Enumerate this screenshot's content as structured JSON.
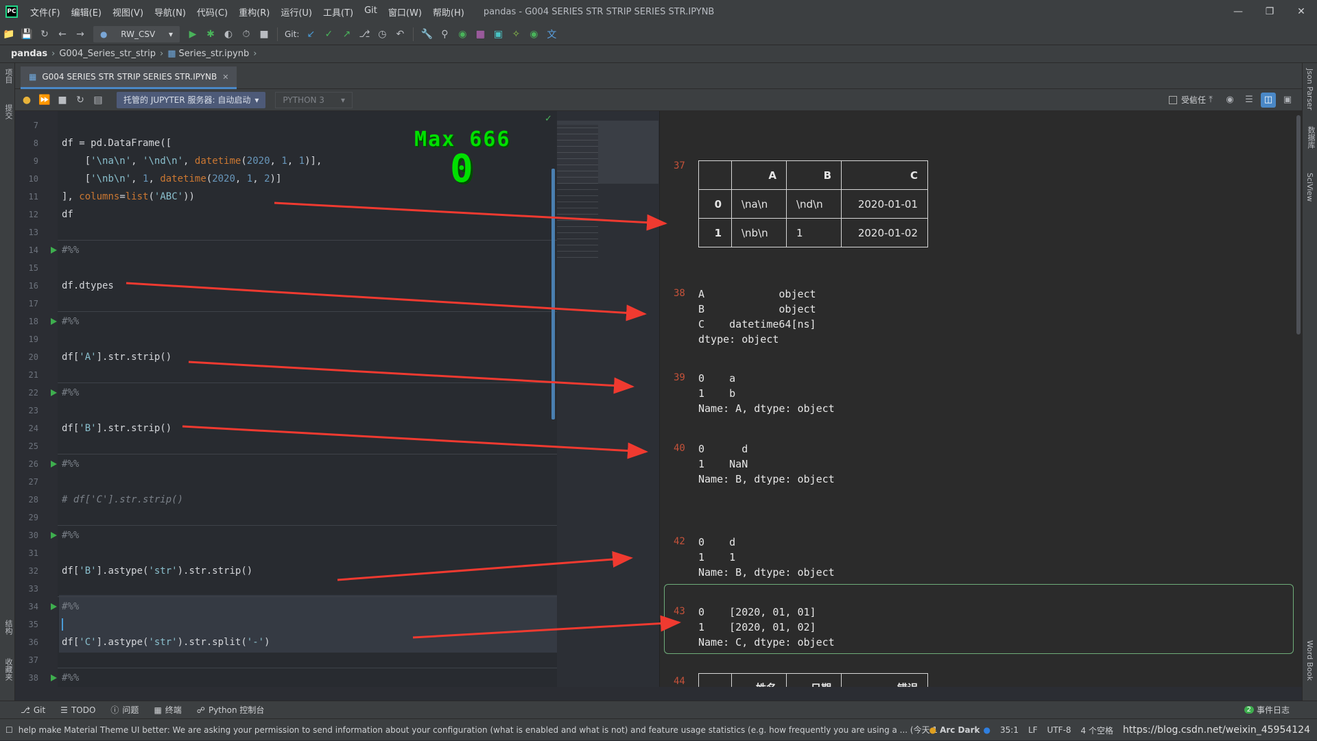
{
  "titlebar": {
    "menu": [
      "文件(F)",
      "编辑(E)",
      "视图(V)",
      "导航(N)",
      "代码(C)",
      "重构(R)",
      "运行(U)",
      "工具(T)",
      "Git",
      "窗口(W)",
      "帮助(H)"
    ],
    "title": "pandas - G004 SERIES STR STRIP SERIES STR.IPYNB"
  },
  "toolbar": {
    "run_config": "RW_CSV",
    "git_label": "Git:"
  },
  "breadcrumbs": {
    "project": "pandas",
    "folder": "G004_Series_str_strip",
    "file": "Series_str.ipynb"
  },
  "tab": {
    "label": "G004 SERIES STR STRIP SERIES STR.IPYNB"
  },
  "notebook": {
    "jupyter": "托管的 JUPYTER 服务器: 自动启动",
    "kernel": "PYTHON 3",
    "trusted": "受信任"
  },
  "side": {
    "left_project": "项目",
    "left_commit": "提交",
    "left_struct": "结构",
    "left_fav": "收藏夹",
    "right_json": "Json Parser",
    "right_db": "数据库",
    "right_sci": "SciView",
    "right_word": "Word Book"
  },
  "overlay": {
    "max_label": "Max 666",
    "max_value": "0"
  },
  "code_lines": [
    {
      "n": "7",
      "code": ""
    },
    {
      "n": "8",
      "code": "df = pd.DataFrame(["
    },
    {
      "n": "9",
      "code": "    ['\\na\\n', '\\nd\\n', datetime(2020, 1, 1)],"
    },
    {
      "n": "10",
      "code": "    ['\\nb\\n', 1, datetime(2020, 1, 2)]"
    },
    {
      "n": "11",
      "code": "], columns=list('ABC'))"
    },
    {
      "n": "12",
      "code": "df"
    },
    {
      "n": "13",
      "code": ""
    },
    {
      "n": "14",
      "code": "#%%"
    },
    {
      "n": "15",
      "code": ""
    },
    {
      "n": "16",
      "code": "df.dtypes"
    },
    {
      "n": "17",
      "code": ""
    },
    {
      "n": "18",
      "code": "#%%"
    },
    {
      "n": "19",
      "code": ""
    },
    {
      "n": "20",
      "code": "df['A'].str.strip()"
    },
    {
      "n": "21",
      "code": ""
    },
    {
      "n": "22",
      "code": "#%%"
    },
    {
      "n": "23",
      "code": ""
    },
    {
      "n": "24",
      "code": "df['B'].str.strip()"
    },
    {
      "n": "25",
      "code": ""
    },
    {
      "n": "26",
      "code": "#%%"
    },
    {
      "n": "27",
      "code": ""
    },
    {
      "n": "28",
      "code": "# df['C'].str.strip()"
    },
    {
      "n": "29",
      "code": ""
    },
    {
      "n": "30",
      "code": "#%%"
    },
    {
      "n": "31",
      "code": ""
    },
    {
      "n": "32",
      "code": "df['B'].astype('str').str.strip()"
    },
    {
      "n": "33",
      "code": ""
    },
    {
      "n": "34",
      "code": "#%%"
    },
    {
      "n": "35",
      "code": ""
    },
    {
      "n": "36",
      "code": "df['C'].astype('str').str.split('-')"
    },
    {
      "n": "37",
      "code": ""
    },
    {
      "n": "38",
      "code": "#%%"
    }
  ],
  "outputs": {
    "o37": {
      "num": "37",
      "table": {
        "headers": [
          "",
          "A",
          "B",
          "C"
        ],
        "rows": [
          [
            "0",
            "\\na\\n",
            "\\nd\\n",
            "2020-01-01"
          ],
          [
            "1",
            "\\nb\\n",
            "1",
            "2020-01-02"
          ]
        ]
      }
    },
    "o38": {
      "num": "38",
      "text": "A            object\nB            object\nC    datetime64[ns]\ndtype: object"
    },
    "o39": {
      "num": "39",
      "text": "0    a\n1    b\nName: A, dtype: object"
    },
    "o40": {
      "num": "40",
      "text": "0      d\n1    NaN\nName: B, dtype: object"
    },
    "o42": {
      "num": "42",
      "text": "0    d\n1    1\nName: B, dtype: object"
    },
    "o43": {
      "num": "43",
      "text": "0    [2020, 01, 01]\n1    [2020, 01, 02]\nName: C, dtype: object"
    },
    "o44": {
      "num": "44",
      "headers": [
        "",
        "姓名",
        "日期",
        "错误"
      ]
    }
  },
  "bottom_tools": [
    "Git",
    "TODO",
    "问题",
    "终端",
    "Python 控制台"
  ],
  "event_log": "事件日志",
  "event_count": "2",
  "status": {
    "message": "help make Material Theme UI better: We are asking your permission to send information about your configuration (what is enabled and what is not) and feature usage statistics (e.g. how frequently you are using a ... (今天 15:17)",
    "theme": "Arc Dark",
    "position": "35:1",
    "line_sep": "LF",
    "encoding": "UTF-8",
    "indent": "4 个空格",
    "watermark": "https://blog.csdn.net/weixin_45954124"
  },
  "colors": {
    "arrow": "#f03a30",
    "counter": "#00e000",
    "output_num": "#c5523a"
  }
}
